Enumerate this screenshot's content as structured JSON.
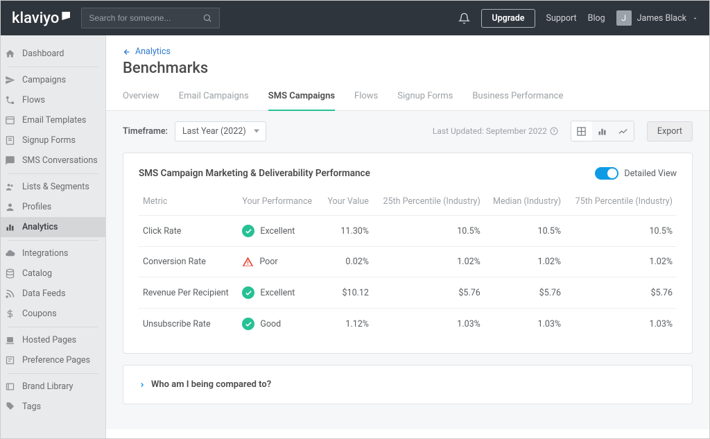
{
  "brand": "klaviyo",
  "search": {
    "placeholder": "Search for someone..."
  },
  "topbar": {
    "upgrade": "Upgrade",
    "support": "Support",
    "blog": "Blog",
    "user_initial": "J",
    "user_name": "James Black"
  },
  "sidebar": {
    "items": [
      "Dashboard",
      "Campaigns",
      "Flows",
      "Email Templates",
      "Signup Forms",
      "SMS Conversations",
      "Lists & Segments",
      "Profiles",
      "Analytics",
      "Integrations",
      "Catalog",
      "Data Feeds",
      "Coupons",
      "Hosted Pages",
      "Preference Pages",
      "Brand Library",
      "Tags"
    ]
  },
  "breadcrumb": "Analytics",
  "page_title": "Benchmarks",
  "tabs": [
    "Overview",
    "Email Campaigns",
    "SMS Campaigns",
    "Flows",
    "Signup Forms",
    "Business Performance"
  ],
  "controls": {
    "timeframe_label": "Timeframe:",
    "timeframe_value": "Last Year (2022)",
    "last_updated": "Last Updated: September 2022",
    "export": "Export"
  },
  "card": {
    "title": "SMS Campaign Marketing & Deliverability Performance",
    "toggle_label": "Detailed View",
    "columns": [
      "Metric",
      "Your Performance",
      "Your Value",
      "25th Percentile (Industry)",
      "Median (Industry)",
      "75th Percentile (Industry)"
    ],
    "rows": [
      {
        "metric": "Click Rate",
        "perf": "Excellent",
        "perf_type": "excellent",
        "value": "11.30%",
        "p25": "10.5%",
        "median": "10.5%",
        "p75": "10.5%"
      },
      {
        "metric": "Conversion Rate",
        "perf": "Poor",
        "perf_type": "poor",
        "value": "0.02%",
        "p25": "1.02%",
        "median": "1.02%",
        "p75": "1.02%"
      },
      {
        "metric": "Revenue Per Recipient",
        "perf": "Excellent",
        "perf_type": "excellent",
        "value": "$10.12",
        "p25": "$5.76",
        "median": "$5.76",
        "p75": "$5.76"
      },
      {
        "metric": "Unsubscribe Rate",
        "perf": "Good",
        "perf_type": "good",
        "value": "1.12%",
        "p25": "1.03%",
        "median": "1.03%",
        "p75": "1.03%"
      }
    ]
  },
  "expand": "Who am I being compared to?"
}
